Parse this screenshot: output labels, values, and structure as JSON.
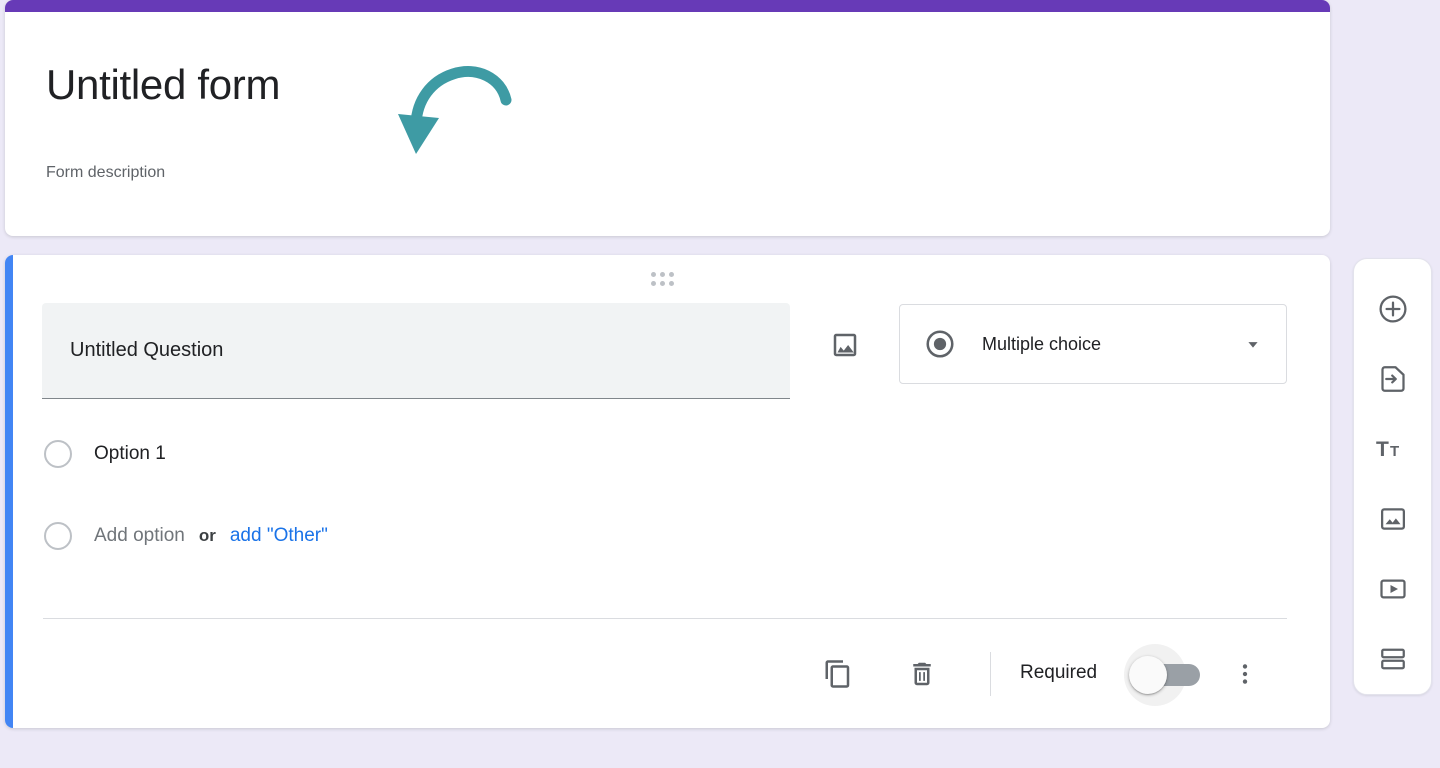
{
  "theme": {
    "header_bar_color": "#673AB7",
    "question_accent_color": "#4285F4",
    "page_background": "#ECE9F7",
    "link_color": "#1A73E8",
    "annotation_arrow_color": "#3E9BA4",
    "icon_color": "#5F6368"
  },
  "header": {
    "title": "Untitled form",
    "description": "Form description",
    "annotation_icon": "curved-arrow-down-left-icon"
  },
  "question": {
    "drag_handle_icon": "drag-handle-dots-icon",
    "title_value": "Untitled Question",
    "title_placeholder": "Question",
    "add_image_icon": "image-icon",
    "type": {
      "icon": "radio-button-icon",
      "label": "Multiple choice",
      "caret_icon": "chevron-down-icon"
    },
    "options": [
      {
        "label": "Option 1",
        "icon": "radio-unchecked-icon"
      }
    ],
    "add_option": {
      "icon": "radio-unchecked-icon",
      "label": "Add option",
      "or_label": "or",
      "other_label": "add \"Other\""
    },
    "footer": {
      "duplicate_icon": "duplicate-icon",
      "duplicate_label": "Duplicate",
      "delete_icon": "trash-icon",
      "delete_label": "Delete",
      "required_label": "Required",
      "required_on": false,
      "more_icon": "more-vertical-icon",
      "more_label": "More options"
    }
  },
  "side_toolbar": {
    "items": [
      {
        "icon": "add-circle-icon",
        "label": "Add question"
      },
      {
        "icon": "import-questions-icon",
        "label": "Import questions"
      },
      {
        "icon": "title-text-icon",
        "label": "Add title and description"
      },
      {
        "icon": "image-icon",
        "label": "Add image"
      },
      {
        "icon": "video-icon",
        "label": "Add video"
      },
      {
        "icon": "section-icon",
        "label": "Add section"
      }
    ]
  }
}
